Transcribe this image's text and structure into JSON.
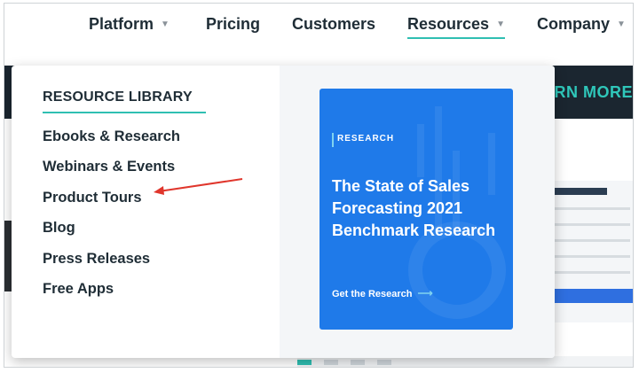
{
  "nav": {
    "items": [
      {
        "label": "Platform",
        "has_menu": true
      },
      {
        "label": "Pricing",
        "has_menu": false
      },
      {
        "label": "Customers",
        "has_menu": false
      },
      {
        "label": "Resources",
        "has_menu": true,
        "active": true
      },
      {
        "label": "Company",
        "has_menu": true
      }
    ],
    "chevron": "▼"
  },
  "background": {
    "learn_more": "RN MORE"
  },
  "resource_library": {
    "heading": "RESOURCE LIBRARY",
    "links": [
      "Ebooks & Research",
      "Webinars & Events",
      "Product Tours",
      "Blog",
      "Press Releases",
      "Free Apps"
    ],
    "annotation": {
      "type": "arrow",
      "points_to": "Product Tours",
      "color": "#e0362c"
    }
  },
  "promo": {
    "tag": "RESEARCH",
    "title": "The State of Sales Forecasting 2021 Benchmark Research",
    "cta": "Get the Research",
    "cta_arrow": "⟶",
    "color": "#1f7ae9"
  },
  "colors": {
    "accent": "#2fbfb2",
    "text": "#1f2d36",
    "dark_band": "#1b2630"
  }
}
